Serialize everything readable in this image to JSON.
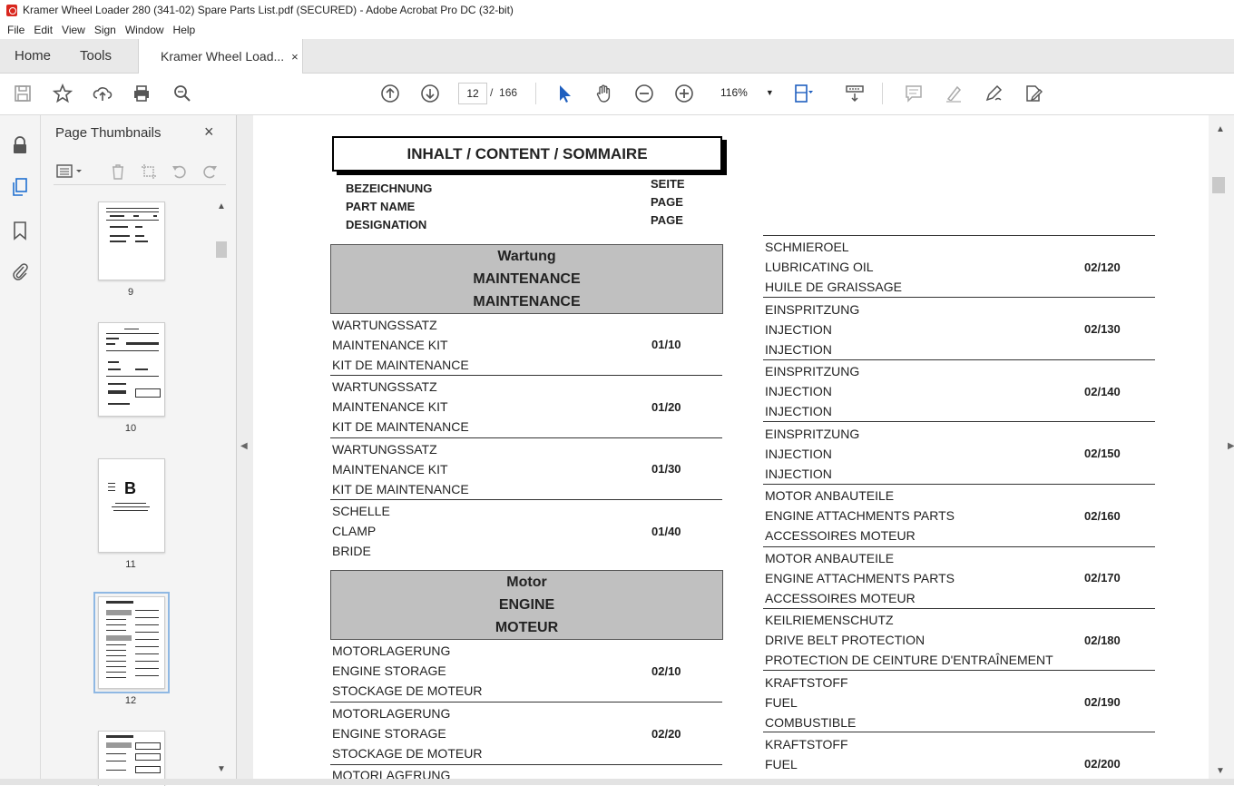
{
  "window": {
    "title": "Kramer Wheel Loader 280 (341-02) Spare Parts List.pdf (SECURED) - Adobe Acrobat Pro DC (32-bit)"
  },
  "menu": [
    "File",
    "Edit",
    "View",
    "Sign",
    "Window",
    "Help"
  ],
  "tabs": {
    "home": "Home",
    "tools": "Tools",
    "doc": "Kramer Wheel Load...",
    "close": "×"
  },
  "toolbar": {
    "page_current": "12",
    "page_sep": "/",
    "page_total": "166",
    "zoom": "116%"
  },
  "thumbnails": {
    "title": "Page Thumbnails",
    "close": "×",
    "pages": [
      "9",
      "10",
      "11",
      "12"
    ],
    "thumb11_letter": "B",
    "selected_page": "12"
  },
  "document": {
    "title": "INHALT / CONTENT / SOMMAIRE",
    "header_left": [
      "BEZEICHNUNG",
      "PART NAME",
      "DESIGNATION"
    ],
    "header_right": [
      "SEITE",
      "PAGE",
      "PAGE"
    ],
    "sections": [
      {
        "lines": [
          "Wartung",
          "MAINTENANCE",
          "MAINTENANCE"
        ]
      },
      {
        "lines": [
          "Motor",
          "ENGINE",
          "MOTEUR"
        ]
      }
    ],
    "left_entries": [
      {
        "de": "WARTUNGSSATZ",
        "en": "MAINTENANCE KIT",
        "fr": "KIT DE MAINTENANCE",
        "page": "01/10"
      },
      {
        "de": "WARTUNGSSATZ",
        "en": "MAINTENANCE KIT",
        "fr": "KIT DE MAINTENANCE",
        "page": "01/20"
      },
      {
        "de": "WARTUNGSSATZ",
        "en": "MAINTENANCE KIT",
        "fr": "KIT DE MAINTENANCE",
        "page": "01/30"
      },
      {
        "de": "SCHELLE",
        "en": "CLAMP",
        "fr": "BRIDE",
        "page": "01/40"
      },
      {
        "de": "MOTORLAGERUNG",
        "en": "ENGINE STORAGE",
        "fr": "STOCKAGE DE MOTEUR",
        "page": "02/10"
      },
      {
        "de": "MOTORLAGERUNG",
        "en": "ENGINE STORAGE",
        "fr": "STOCKAGE DE MOTEUR",
        "page": "02/20"
      },
      {
        "de": "MOTORLAGERUNG",
        "en": "",
        "fr": "",
        "page": ""
      }
    ],
    "right_entries": [
      {
        "de": "SCHMIEROEL",
        "en": "LUBRICATING OIL",
        "fr": "HUILE DE GRAISSAGE",
        "page": "02/120"
      },
      {
        "de": "EINSPRITZUNG",
        "en": "INJECTION",
        "fr": "INJECTION",
        "page": "02/130"
      },
      {
        "de": "EINSPRITZUNG",
        "en": "INJECTION",
        "fr": "INJECTION",
        "page": "02/140"
      },
      {
        "de": "EINSPRITZUNG",
        "en": "INJECTION",
        "fr": "INJECTION",
        "page": "02/150"
      },
      {
        "de": "MOTOR ANBAUTEILE",
        "en": "ENGINE ATTACHMENTS PARTS",
        "fr": "ACCESSOIRES MOTEUR",
        "page": "02/160"
      },
      {
        "de": "MOTOR ANBAUTEILE",
        "en": "ENGINE ATTACHMENTS PARTS",
        "fr": "ACCESSOIRES MOTEUR",
        "page": "02/170"
      },
      {
        "de": "KEILRIEMENSCHUTZ",
        "en": "DRIVE BELT PROTECTION",
        "fr": "PROTECTION DE CEINTURE D'ENTRAÎNEMENT",
        "page": "02/180"
      },
      {
        "de": "KRAFTSTOFF",
        "en": "FUEL",
        "fr": "COMBUSTIBLE",
        "page": "02/190"
      },
      {
        "de": "KRAFTSTOFF",
        "en": "FUEL",
        "fr": "",
        "page": "02/200"
      }
    ]
  }
}
